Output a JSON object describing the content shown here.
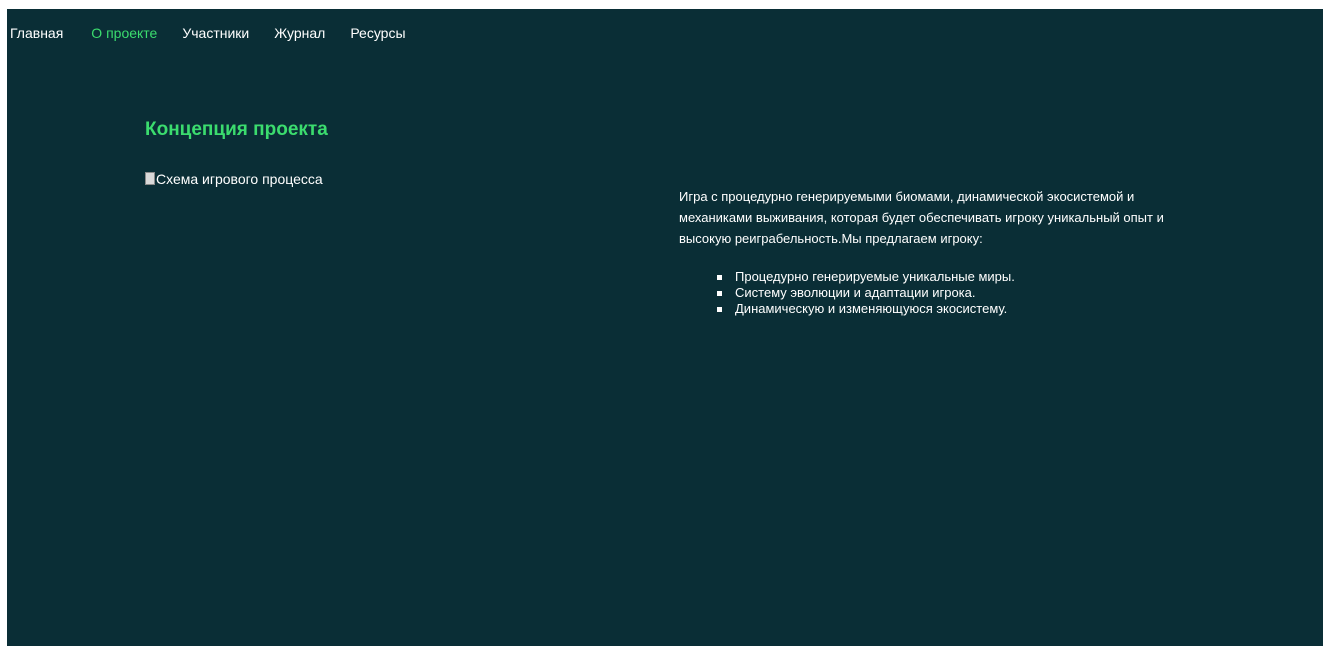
{
  "nav": {
    "items": [
      {
        "label": "Главная"
      },
      {
        "label": "О проекте"
      },
      {
        "label": "Участники"
      },
      {
        "label": "Журнал"
      },
      {
        "label": "Ресурсы"
      }
    ],
    "active": "О проекте",
    "active_color": "#3bdc6e"
  },
  "main": {
    "title": "Концепция проекта",
    "image_alt": "Схема игрового процесса",
    "description": "Игра с процедурно генерируемыми биомами, динамической экосистемой и механиками выживания, которая будет обеспечивать игроку уникальный опыт и высокую реиграбельность.Мы предлагаем игроку:",
    "features": [
      "Процедурно генерируемые уникальные миры.",
      "Систему эволюции и адаптации игрока.",
      "Динамическую и изменяющуюся экосистему."
    ]
  },
  "colors": {
    "background": "#0a2e36",
    "accent": "#3bdc6e",
    "text": "#ffffff"
  }
}
